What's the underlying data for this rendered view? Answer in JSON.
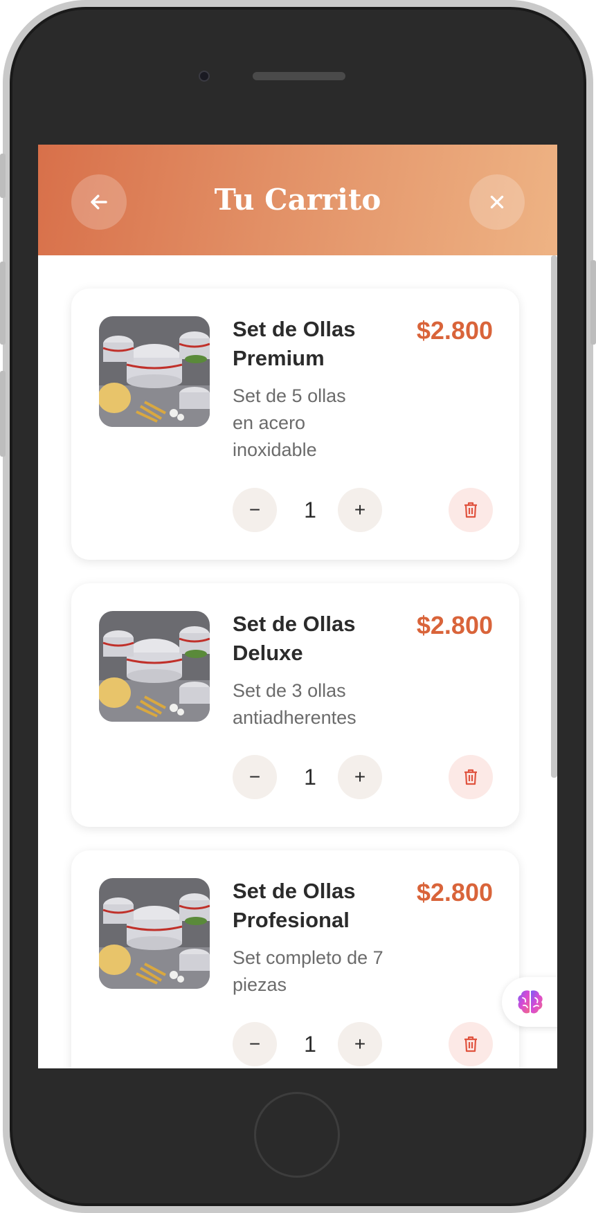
{
  "header": {
    "title": "Tu Carrito",
    "back_icon": "arrow-left-icon",
    "close_icon": "close-icon"
  },
  "cart": {
    "items": [
      {
        "name": "Set de Ollas Premium",
        "description": "Set de 5 ollas en acero inoxidable",
        "price": "$2.800",
        "quantity": "1",
        "minus_label": "−",
        "plus_label": "+"
      },
      {
        "name": "Set de Ollas Deluxe",
        "description": "Set de 3 ollas antiadherentes",
        "price": "$2.800",
        "quantity": "1",
        "minus_label": "−",
        "plus_label": "+"
      },
      {
        "name": "Set de Ollas Profesional",
        "description": "Set completo de 7 piezas",
        "price": "$2.800",
        "quantity": "1",
        "minus_label": "−",
        "plus_label": "+"
      }
    ]
  },
  "colors": {
    "accent": "#d9643a",
    "header_start": "#d8704a",
    "header_end": "#eeb384",
    "delete_icon": "#e0533f"
  },
  "ai_button": {
    "icon": "brain-icon"
  }
}
